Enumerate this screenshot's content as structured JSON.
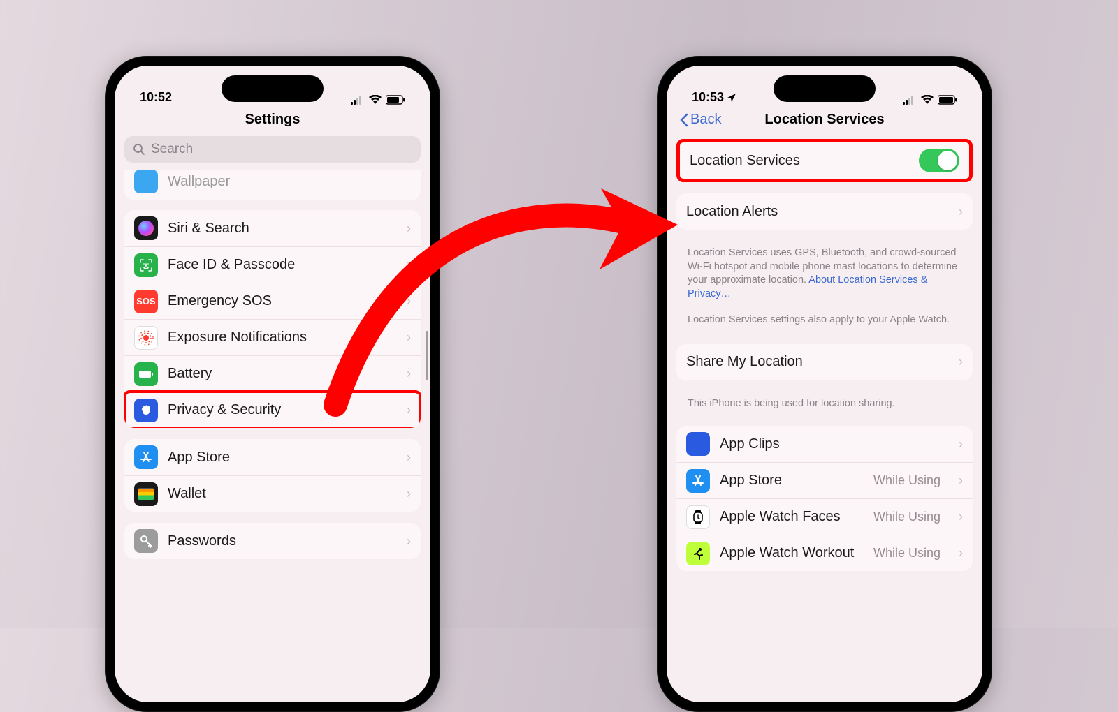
{
  "left": {
    "time": "10:52",
    "title": "Settings",
    "search_placeholder": "Search",
    "partial_row": "Wallpaper",
    "rows1": [
      {
        "label": "Siri & Search",
        "icon_bg": "#1a1a1a",
        "icon": "siri"
      },
      {
        "label": "Face ID & Passcode",
        "icon_bg": "#28b24b",
        "icon": "faceid"
      },
      {
        "label": "Emergency SOS",
        "icon_bg": "#ff3b30",
        "icon": "sos"
      },
      {
        "label": "Exposure Notifications",
        "icon_bg": "#ffffff",
        "icon": "exposure"
      },
      {
        "label": "Battery",
        "icon_bg": "#28b24b",
        "icon": "battery"
      },
      {
        "label": "Privacy & Security",
        "icon_bg": "#2a5ae0",
        "icon": "hand",
        "highlight": true
      }
    ],
    "rows2": [
      {
        "label": "App Store",
        "icon_bg": "#1f8ff2",
        "icon": "appstore"
      },
      {
        "label": "Wallet",
        "icon_bg": "#1a1a1a",
        "icon": "wallet"
      }
    ],
    "rows3": [
      {
        "label": "Passwords",
        "icon_bg": "#9c9c9c",
        "icon": "key"
      }
    ]
  },
  "right": {
    "time": "10:53",
    "back": "Back",
    "title": "Location Services",
    "toggle_label": "Location Services",
    "alerts_label": "Location Alerts",
    "desc1": "Location Services uses GPS, Bluetooth, and crowd-sourced Wi-Fi hotspot and mobile phone mast locations to determine your approximate location. ",
    "desc1_link": "About Location Services & Privacy…",
    "desc2": "Location Services settings also apply to your Apple Watch.",
    "share_label": "Share My Location",
    "share_footer": "This iPhone is being used for location sharing.",
    "apps": [
      {
        "label": "App Clips",
        "value": "",
        "icon_bg": "#2a5ae0",
        "icon": "appclips"
      },
      {
        "label": "App Store",
        "value": "While Using",
        "icon_bg": "#1f8ff2",
        "icon": "appstore"
      },
      {
        "label": "Apple Watch Faces",
        "value": "While Using",
        "icon_bg": "#ffffff",
        "icon": "watch"
      },
      {
        "label": "Apple Watch Workout",
        "value": "While Using",
        "icon_bg": "#bfff3a",
        "icon": "workout"
      }
    ]
  }
}
